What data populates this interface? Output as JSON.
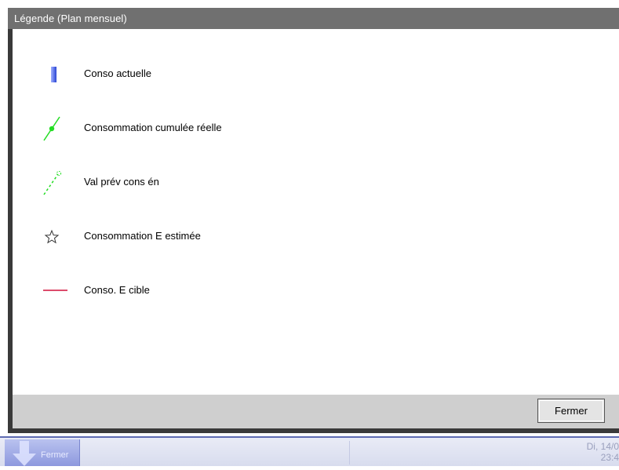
{
  "dialog": {
    "title": "Légende (Plan mensuel)",
    "close_label": "Fermer"
  },
  "legend": [
    {
      "icon": "blue-bar-icon",
      "label": "Conso actuelle",
      "color": "#3a5bd8"
    },
    {
      "icon": "green-line-dot-icon",
      "label": "Consommation cumulée réelle",
      "color": "#22dd22"
    },
    {
      "icon": "green-dashed-line-icon",
      "label": "Val prév cons én",
      "color": "#22dd22"
    },
    {
      "icon": "star-outline-icon",
      "label": "Consommation E estimée",
      "color": "#333333"
    },
    {
      "icon": "red-line-icon",
      "label": "Conso. E cible",
      "color": "#d0103a"
    }
  ],
  "taskbar": {
    "button_label": "Fermer",
    "clock_date": "Di, 14/0",
    "clock_time": "23:4"
  }
}
